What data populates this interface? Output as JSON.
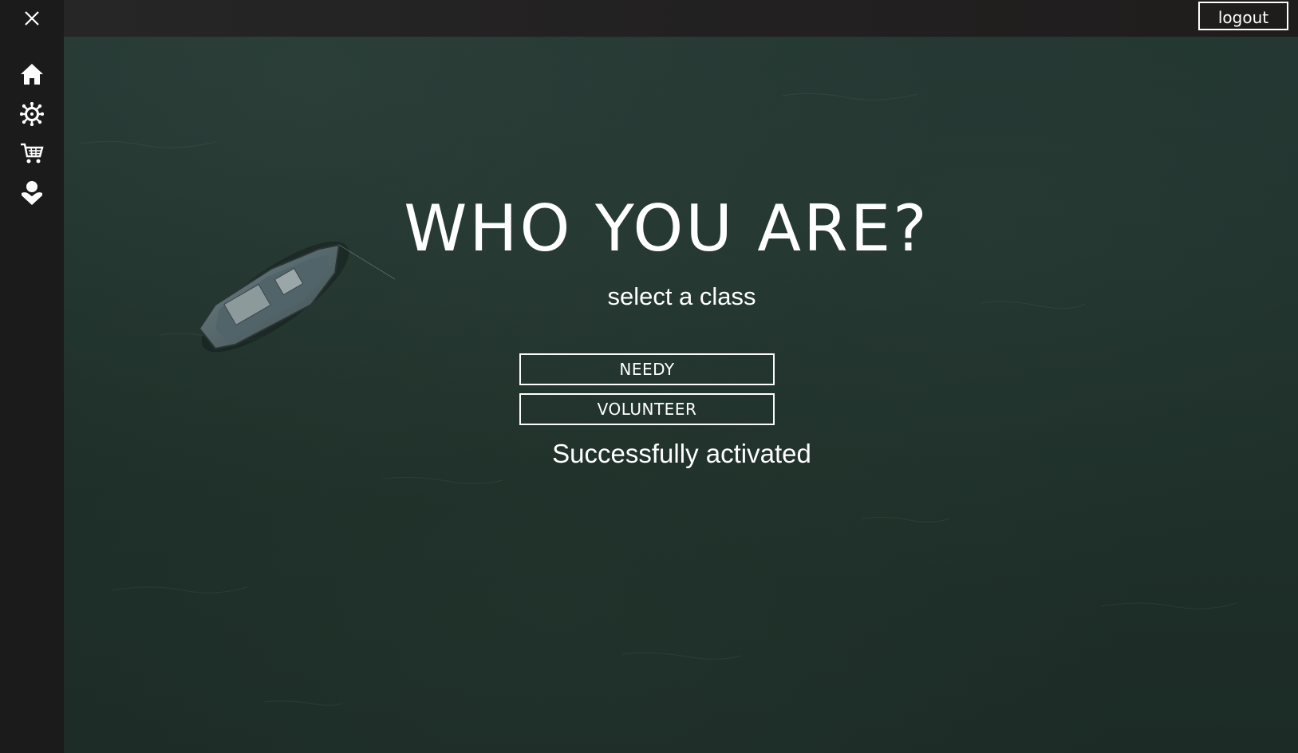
{
  "app": {
    "title": "WHO YOU ARE?"
  },
  "sidebar": {
    "close_icon": "close-icon",
    "items": [
      {
        "icon": "home-icon"
      },
      {
        "icon": "virus-icon"
      },
      {
        "icon": "cart-icon"
      },
      {
        "icon": "heart-hand-icon"
      }
    ]
  },
  "header": {
    "logout_label": "logout"
  },
  "main": {
    "title": "WHO YOU ARE?",
    "subtitle": "select a class",
    "classes": [
      {
        "label": "NEEDY"
      },
      {
        "label": "VOLUNTEER"
      }
    ],
    "status": "Successfully activated"
  },
  "colors": {
    "sidebar": "#1b1b1b",
    "topbar": "#232222",
    "background": "#1f302a",
    "text": "#ffffff"
  }
}
